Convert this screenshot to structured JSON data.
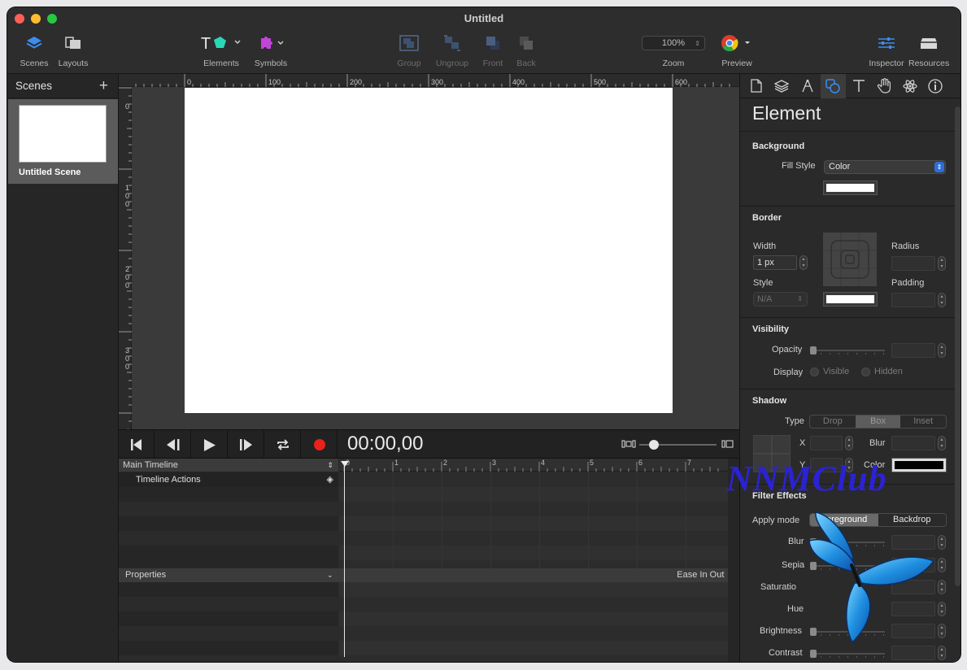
{
  "window": {
    "title": "Untitled"
  },
  "toolbar": {
    "scenes_label": "Scenes",
    "layouts_label": "Layouts",
    "elements_label": "Elements",
    "symbols_label": "Symbols",
    "group_label": "Group",
    "ungroup_label": "Ungroup",
    "front_label": "Front",
    "back_label": "Back",
    "zoom_label": "Zoom",
    "zoom_value": "100%",
    "preview_label": "Preview",
    "inspector_label": "Inspector",
    "resources_label": "Resources"
  },
  "scenes_panel": {
    "title": "Scenes",
    "add": "+",
    "items": [
      {
        "name": "Untitled Scene"
      }
    ]
  },
  "rulers": {
    "top": [
      "0",
      "100",
      "200",
      "300",
      "400",
      "500",
      "600"
    ],
    "left": [
      "0",
      "1\n0\n0",
      "2\n0\n0",
      "3\n0\n0",
      "4"
    ]
  },
  "transport": {
    "timecode": "00:00,00"
  },
  "timeline": {
    "main_label": "Main Timeline",
    "actions_label": "Timeline Actions",
    "ticks": [
      "0",
      "1",
      "2",
      "3",
      "4",
      "5",
      "6",
      "7"
    ],
    "properties_label": "Properties",
    "easing": "Ease In Out"
  },
  "inspector": {
    "title": "Element",
    "background": {
      "heading": "Background",
      "fill_style_label": "Fill Style",
      "fill_style_value": "Color"
    },
    "border": {
      "heading": "Border",
      "width_label": "Width",
      "width_value": "1 px",
      "style_label": "Style",
      "style_value": "N/A",
      "radius_label": "Radius",
      "padding_label": "Padding"
    },
    "visibility": {
      "heading": "Visibility",
      "opacity_label": "Opacity",
      "display_label": "Display",
      "visible": "Visible",
      "hidden": "Hidden"
    },
    "shadow": {
      "heading": "Shadow",
      "type_label": "Type",
      "types": [
        "Drop",
        "Box",
        "Inset"
      ],
      "selected_type": "Box",
      "x_label": "X",
      "y_label": "Y",
      "blur_label": "Blur",
      "color_label": "Color"
    },
    "filter": {
      "heading": "Filter Effects",
      "apply_mode_label": "Apply mode",
      "modes": [
        "Foreground",
        "Backdrop"
      ],
      "selected_mode": "Foreground",
      "blur": "Blur",
      "sepia": "Sepia",
      "saturation": "Saturatio",
      "hue": "Hue",
      "brightness": "Brightness",
      "contrast": "Contrast"
    }
  },
  "watermark": {
    "text": "NNMClub"
  },
  "colors": {
    "accent": "#3b8df0",
    "record": "#e8221c",
    "window_bg": "#282828"
  }
}
